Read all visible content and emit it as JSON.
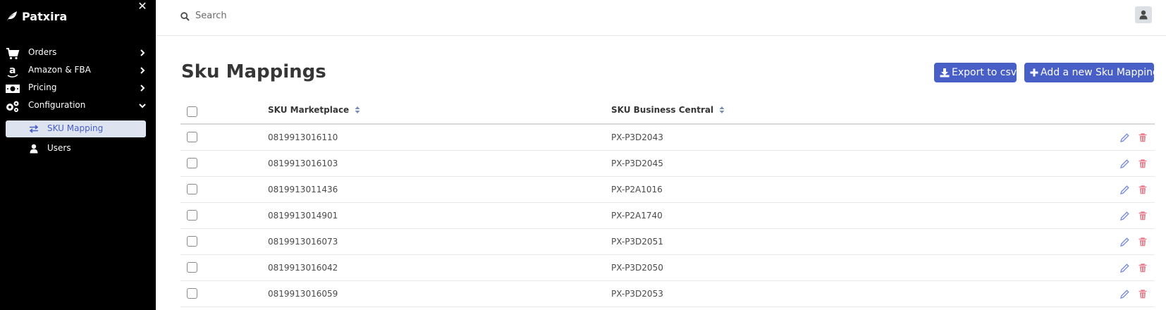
{
  "app": {
    "name": "Patxira"
  },
  "sidebar": {
    "close_icon": "close-icon",
    "items": [
      {
        "label": "Orders",
        "icon": "cart-icon",
        "expanded": false
      },
      {
        "label": "Amazon & FBA",
        "icon": "amazon-icon",
        "expanded": false
      },
      {
        "label": "Pricing",
        "icon": "money-icon",
        "expanded": false
      },
      {
        "label": "Configuration",
        "icon": "gears-icon",
        "expanded": true
      }
    ],
    "subitems": [
      {
        "label": "SKU Mapping",
        "icon": "exchange-icon",
        "active": true
      },
      {
        "label": "Users",
        "icon": "user-icon",
        "active": false
      }
    ]
  },
  "topbar": {
    "search_placeholder": "Search",
    "avatar_icon": "user-avatar-icon"
  },
  "main": {
    "title": "Sku Mappings",
    "export_label": "Export to csv",
    "add_label": "Add a new Sku Mapping"
  },
  "table": {
    "columns": [
      "SKU Marketplace",
      "SKU Business Central"
    ],
    "rows": [
      {
        "marketplace": "0819913016110",
        "business_central": "PX-P3D2043"
      },
      {
        "marketplace": "0819913016103",
        "business_central": "PX-P3D2045"
      },
      {
        "marketplace": "0819913011436",
        "business_central": "PX-P2A1016"
      },
      {
        "marketplace": "0819913014901",
        "business_central": "PX-P2A1740"
      },
      {
        "marketplace": "0819913016073",
        "business_central": "PX-P3D2051"
      },
      {
        "marketplace": "0819913016042",
        "business_central": "PX-P3D2050"
      },
      {
        "marketplace": "0819913016059",
        "business_central": "PX-P3D2053"
      }
    ]
  },
  "colors": {
    "sidebar_bg": "#000000",
    "accent": "#485fc7",
    "active_sub_bg": "#dde4ef",
    "edit_icon": "#7b8fd9",
    "delete_icon": "#e8808f"
  }
}
